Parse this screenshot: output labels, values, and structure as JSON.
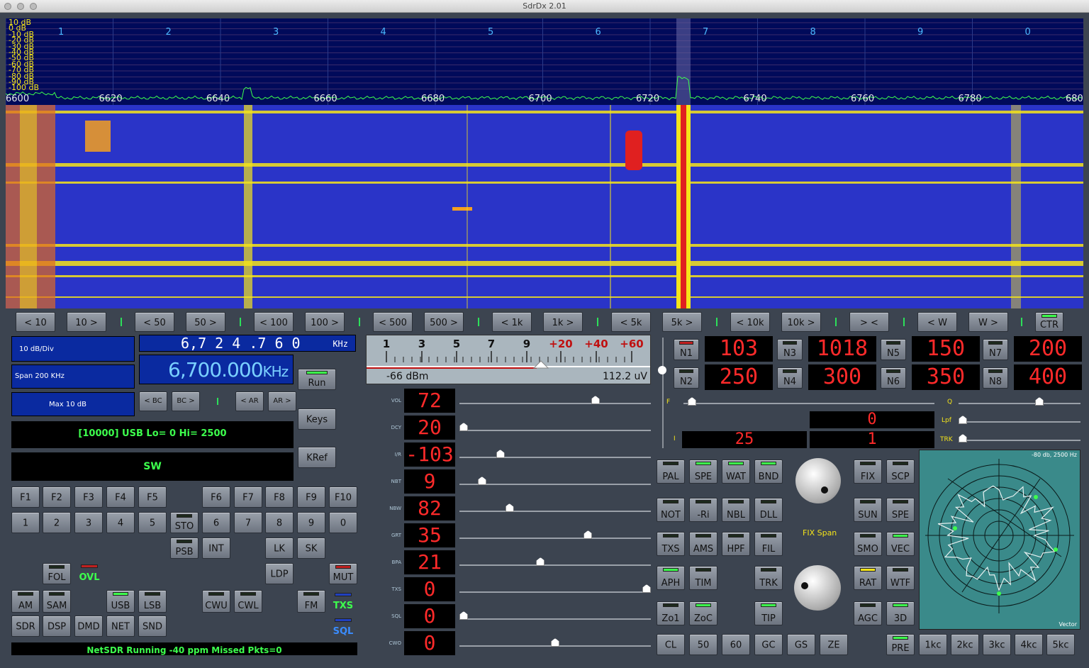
{
  "window": {
    "title": "SdrDx 2.01"
  },
  "spectrum": {
    "db_labels": [
      "10 dB",
      "0 dB",
      "-10 dB",
      "-20 dB",
      "-30 dB",
      "-40 dB",
      "-50 dB",
      "-60 dB",
      "-70 dB",
      "-80 dB",
      "-90 dB",
      "-100 dB"
    ],
    "marker_labels": [
      "1",
      "2",
      "3",
      "4",
      "5",
      "6",
      "7",
      "8",
      "9",
      "0"
    ],
    "freq_labels": [
      "6600",
      "6620",
      "6640",
      "6660",
      "6680",
      "6700",
      "6720",
      "6740",
      "6760",
      "6780",
      "6800"
    ]
  },
  "step_buttons": [
    "< 10",
    "10 >",
    "< 50",
    "50 >",
    "< 100",
    "100 >",
    "< 500",
    "500 >",
    "< 1k",
    "1k >",
    "< 5k",
    "5k >",
    "< 10k",
    "10k >",
    "> <",
    "< W",
    "W >"
  ],
  "ctr_label": "CTR",
  "left": {
    "db_div": "10 dB/Div",
    "span": "Span 200 KHz",
    "max": "Max 10 dB",
    "freq_big": "6,7 2 4 .7 6 0",
    "freq_unit": "KHz",
    "center": "6,700.000",
    "center_unit": "KHz",
    "bc_buttons": [
      "< BC",
      "BC >",
      "< AR",
      "AR >"
    ],
    "mode_line": "[10000] USB Lo= 0 Hi= 2500",
    "band": "SW",
    "run": "Run",
    "keys": "Keys",
    "kref": "KRef",
    "fkeys": [
      "F1",
      "F2",
      "F3",
      "F4",
      "F5",
      "F6",
      "F7",
      "F8",
      "F9",
      "F10"
    ],
    "num_left": [
      "1",
      "2",
      "3",
      "4",
      "5"
    ],
    "num_right": [
      "6",
      "7",
      "8",
      "9",
      "0"
    ],
    "sto": "STO",
    "psb": "PSB",
    "int": "INT",
    "lk": "LK",
    "sk": "SK",
    "ldp": "LDP",
    "mut": "MUT",
    "fol": "FOL",
    "ovl": "OVL",
    "txs": "TXS",
    "sql": "SQL",
    "modes": [
      "AM",
      "SAM",
      "USB",
      "LSB",
      "CWU",
      "CWL",
      "FM"
    ],
    "bottom": [
      "SDR",
      "DSP",
      "DMD",
      "NET",
      "SND"
    ],
    "status": "NetSDR Running  -40 ppm  Missed Pkts=0"
  },
  "smeter": {
    "scale": [
      "1",
      "3",
      "5",
      "7",
      "9",
      "+20",
      "+40",
      "+60"
    ],
    "dbm": "-66 dBm",
    "uv": "112.2 uV"
  },
  "sliders": [
    {
      "label": "VOL",
      "value": "72",
      "pos": 0.72
    },
    {
      "label": "DCY",
      "value": "20",
      "pos": 0.0
    },
    {
      "label": "I/R",
      "value": "-103",
      "pos": 0.2
    },
    {
      "label": "NBT",
      "value": "9",
      "pos": 0.1
    },
    {
      "label": "NBW",
      "value": "82",
      "pos": 0.25
    },
    {
      "label": "GRT",
      "value": "35",
      "pos": 0.68
    },
    {
      "label": "BPA",
      "value": "21",
      "pos": 0.42
    },
    {
      "label": "TXS",
      "value": "0",
      "pos": 1.0
    },
    {
      "label": "SQL",
      "value": "0",
      "pos": 0.0
    },
    {
      "label": "CWO",
      "value": "0",
      "pos": 0.5
    }
  ],
  "notches": [
    {
      "label": "N1",
      "value": "103"
    },
    {
      "label": "N3",
      "value": "1018"
    },
    {
      "label": "N5",
      "value": "150"
    },
    {
      "label": "N7",
      "value": "200"
    },
    {
      "label": "N2",
      "value": "250"
    },
    {
      "label": "N4",
      "value": "300"
    },
    {
      "label": "N6",
      "value": "350"
    },
    {
      "label": "N8",
      "value": "400"
    }
  ],
  "filters": {
    "f_label": "F",
    "q_label": "Q",
    "lpf_label": "Lpf",
    "trk_label": "TRK",
    "i_label": "I",
    "val_top": "0",
    "val_i": "25",
    "val_r": "1"
  },
  "func_left": [
    [
      "PAL",
      "SPE",
      "WAT",
      "BND"
    ],
    [
      "NOT",
      "-Ri",
      "NBL",
      "DLL"
    ],
    [
      "TXS",
      "AMS",
      "HPF",
      "FIL"
    ],
    [
      "APH",
      "TIM",
      "",
      "TRK"
    ],
    [
      "Zo1",
      "ZoC",
      "",
      "TIP"
    ]
  ],
  "func_right": [
    [
      "FIX",
      "SCP"
    ],
    [
      "SUN",
      "SPE"
    ],
    [
      "SMO",
      "VEC"
    ],
    [
      "RAT",
      "WTF"
    ],
    [
      "AGC",
      "3D"
    ]
  ],
  "knob_label": "FIX Span",
  "bottom_row": [
    "CL",
    "50",
    "60",
    "GC",
    "GS",
    "ZE"
  ],
  "pre": "PRE",
  "span_buttons": [
    "1kc",
    "2kc",
    "3kc",
    "4kc",
    "5kc"
  ],
  "vector": {
    "header": "-80 db, 2500 Hz",
    "footer": "Vector"
  },
  "colors": {
    "accent_green": "#3dff4d",
    "seg_red": "#ff2a2a",
    "wf_blue": "#2a34c8",
    "spectrum_bg": "#000a5a"
  }
}
